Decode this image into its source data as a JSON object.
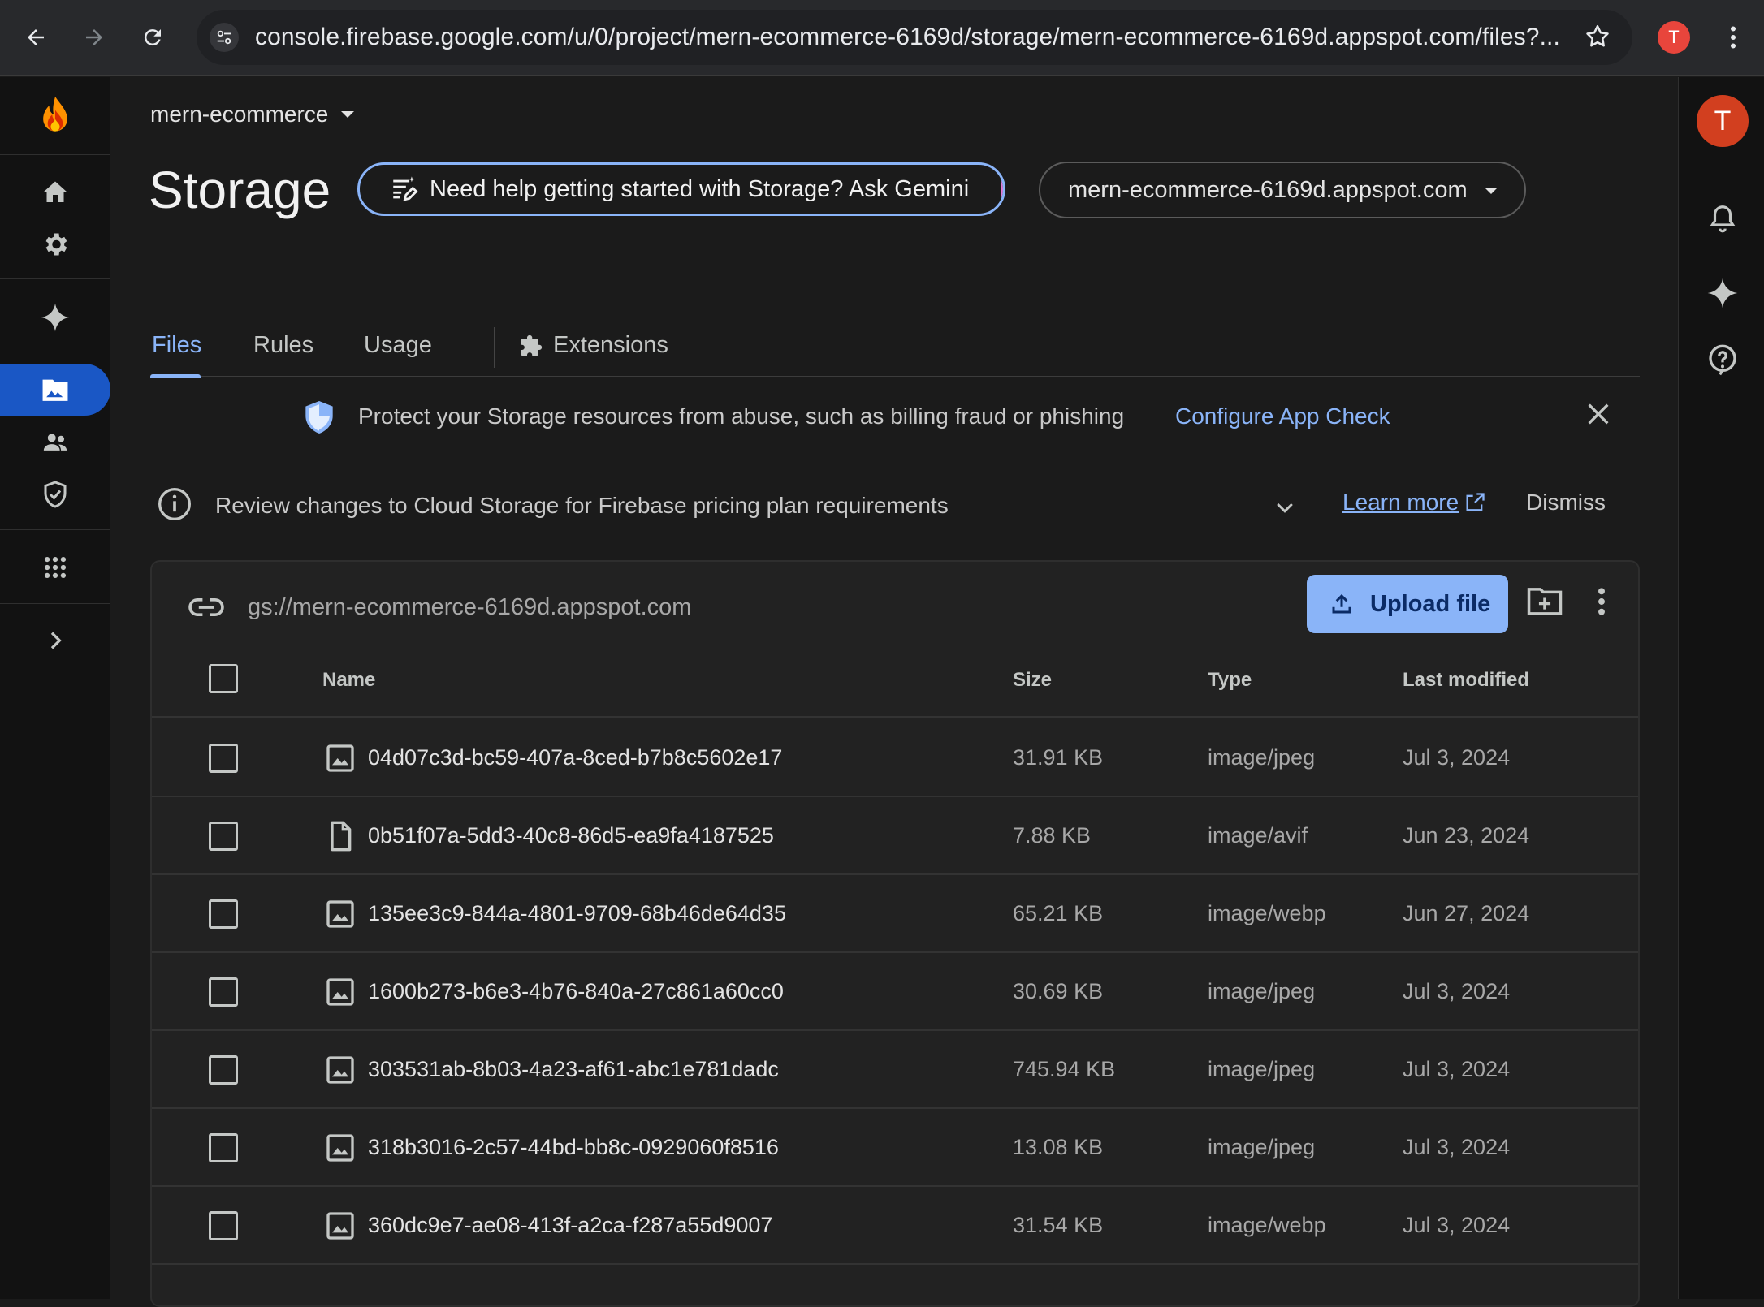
{
  "browser": {
    "url": "console.firebase.google.com/u/0/project/mern-ecommerce-6169d/storage/mern-ecommerce-6169d.appspot.com/files?...",
    "profile_initial": "T"
  },
  "header": {
    "project_name": "mern-ecommerce",
    "title": "Storage",
    "gemini_prompt": "Need help getting started with Storage? Ask Gemini",
    "bucket": "mern-ecommerce-6169d.appspot.com",
    "avatar_initial": "T"
  },
  "tabs": [
    {
      "label": "Files",
      "active": true
    },
    {
      "label": "Rules",
      "active": false
    },
    {
      "label": "Usage",
      "active": false
    },
    {
      "label": "Extensions",
      "active": false
    }
  ],
  "app_check_banner": {
    "text": "Protect your Storage resources from abuse, such as billing fraud or phishing",
    "link": "Configure App Check"
  },
  "pricing_notice": {
    "text": "Review changes to Cloud Storage for Firebase pricing plan requirements",
    "learn_more": "Learn more",
    "dismiss": "Dismiss"
  },
  "files_panel": {
    "path": "gs://mern-ecommerce-6169d.appspot.com",
    "upload_label": "Upload file",
    "columns": {
      "name": "Name",
      "size": "Size",
      "type": "Type",
      "modified": "Last modified"
    },
    "rows": [
      {
        "icon": "image-file-icon",
        "name": "04d07c3d-bc59-407a-8ced-b7b8c5602e17",
        "size": "31.91 KB",
        "type": "image/jpeg",
        "modified": "Jul 3, 2024"
      },
      {
        "icon": "generic-file-icon",
        "name": "0b51f07a-5dd3-40c8-86d5-ea9fa4187525",
        "size": "7.88 KB",
        "type": "image/avif",
        "modified": "Jun 23, 2024"
      },
      {
        "icon": "image-file-icon",
        "name": "135ee3c9-844a-4801-9709-68b46de64d35",
        "size": "65.21 KB",
        "type": "image/webp",
        "modified": "Jun 27, 2024"
      },
      {
        "icon": "image-file-icon",
        "name": "1600b273-b6e3-4b76-840a-27c861a60cc0",
        "size": "30.69 KB",
        "type": "image/jpeg",
        "modified": "Jul 3, 2024"
      },
      {
        "icon": "image-file-icon",
        "name": "303531ab-8b03-4a23-af61-abc1e781dadc",
        "size": "745.94 KB",
        "type": "image/jpeg",
        "modified": "Jul 3, 2024"
      },
      {
        "icon": "image-file-icon",
        "name": "318b3016-2c57-44bd-bb8c-0929060f8516",
        "size": "13.08 KB",
        "type": "image/jpeg",
        "modified": "Jul 3, 2024"
      },
      {
        "icon": "image-file-icon",
        "name": "360dc9e7-ae08-413f-a2ca-f287a55d9007",
        "size": "31.54 KB",
        "type": "image/webp",
        "modified": "Jul 3, 2024"
      }
    ]
  },
  "colors": {
    "accent": "#8ab4f8",
    "active_nav": "#1a57c5",
    "background": "#1b1b1b"
  }
}
